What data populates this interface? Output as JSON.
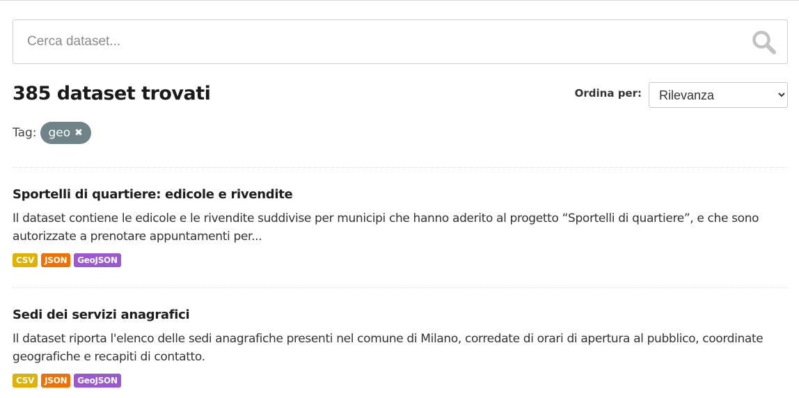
{
  "search": {
    "placeholder": "Cerca dataset...",
    "value": ""
  },
  "results": {
    "count_text": "385 dataset trovati"
  },
  "sort": {
    "label": "Ordina per:",
    "selected": "Rilevanza",
    "options": [
      "Rilevanza"
    ]
  },
  "tags": {
    "label": "Tag:",
    "active": [
      {
        "name": "geo",
        "remove_glyph": "✖"
      }
    ]
  },
  "format_colors": {
    "CSV": "#dfb100",
    "JSON": "#ef7100",
    "GeoJSON": "#9b59d0"
  },
  "datasets": [
    {
      "title": "Sportelli di quartiere: edicole e rivendite",
      "description": "Il dataset contiene le edicole e le rivendite suddivise per municipi che hanno aderito al progetto “Sportelli di quartiere”, e che sono autorizzate a prenotare appuntamenti per...",
      "formats": [
        "CSV",
        "JSON",
        "GeoJSON"
      ]
    },
    {
      "title": "Sedi dei servizi anagrafici",
      "description": "Il dataset riporta l'elenco delle sedi anagrafiche presenti nel comune di Milano, corredate di orari di apertura al pubblico, coordinate geografiche e recapiti di contatto.",
      "formats": [
        "CSV",
        "JSON",
        "GeoJSON"
      ]
    }
  ],
  "icons": {
    "search": "search-icon",
    "dropdown": "chevron-down-icon",
    "tag_remove": "close-icon"
  }
}
